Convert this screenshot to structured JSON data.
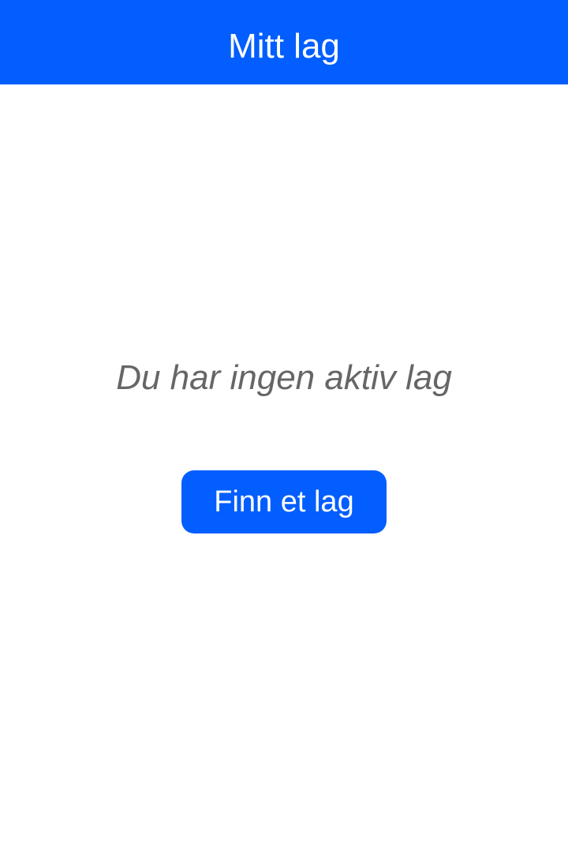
{
  "header": {
    "title": "Mitt lag"
  },
  "main": {
    "empty_message": "Du har ingen aktiv lag",
    "find_team_button_label": "Finn et lag"
  },
  "colors": {
    "primary": "#025efe",
    "background": "#ffffff",
    "muted_text": "#666666",
    "on_primary": "#ffffff"
  }
}
